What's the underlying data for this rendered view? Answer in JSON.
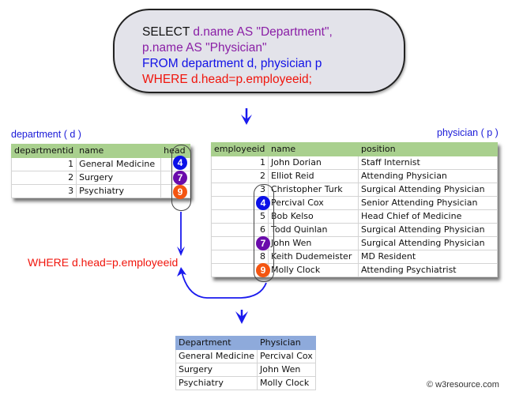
{
  "query": {
    "select_keyword": "SELECT",
    "select_expr1": "d.name AS \"Department\",",
    "select_expr2": "p.name AS \"Physician\"",
    "from_clause": "FROM department d, physician p",
    "where_clause": "WHERE d.head=p.employeeid;"
  },
  "department_table": {
    "caption": "department ( d )",
    "columns": [
      "departmentid",
      "name",
      "head"
    ],
    "rows": [
      {
        "departmentid": "1",
        "name": "General Medicine",
        "head": "4"
      },
      {
        "departmentid": "2",
        "name": "Surgery",
        "head": "7"
      },
      {
        "departmentid": "3",
        "name": "Psychiatry",
        "head": "9"
      }
    ]
  },
  "physician_table": {
    "caption": "physician ( p )",
    "columns": [
      "employeeid",
      "name",
      "position"
    ],
    "rows": [
      {
        "employeeid": "1",
        "name": "John Dorian",
        "position": "Staff Internist"
      },
      {
        "employeeid": "2",
        "name": "Elliot Reid",
        "position": "Attending Physician"
      },
      {
        "employeeid": "3",
        "name": "Christopher Turk",
        "position": "Surgical Attending Physician"
      },
      {
        "employeeid": "4",
        "name": "Percival Cox",
        "position": "Senior Attending Physician"
      },
      {
        "employeeid": "5",
        "name": "Bob Kelso",
        "position": "Head Chief of Medicine"
      },
      {
        "employeeid": "6",
        "name": "Todd Quinlan",
        "position": "Surgical Attending Physician"
      },
      {
        "employeeid": "7",
        "name": "John Wen",
        "position": "Surgical Attending Physician"
      },
      {
        "employeeid": "8",
        "name": "Keith Dudemeister",
        "position": "MD Resident"
      },
      {
        "employeeid": "9",
        "name": "Molly Clock",
        "position": "Attending Psychiatrist"
      }
    ]
  },
  "badges": [
    {
      "value": "4",
      "color": "#0b10e8"
    },
    {
      "value": "7",
      "color": "#6a0bab"
    },
    {
      "value": "9",
      "color": "#f45511"
    }
  ],
  "join_condition_label": "WHERE d.head=p.employeeid",
  "result_table": {
    "columns": [
      "Department",
      "Physician"
    ],
    "rows": [
      {
        "department": "General Medicine",
        "physician": "Percival Cox"
      },
      {
        "department": "Surgery",
        "physician": "John Wen"
      },
      {
        "department": "Psychiatry",
        "physician": "Molly Clock"
      }
    ]
  },
  "footer": {
    "copyright_icon": "©",
    "site": "w3resource.com"
  },
  "colors": {
    "arrow": "#1a1aee",
    "header_green": "#a9d08e",
    "header_blue": "#8eaadb",
    "where_red": "#f0150c"
  }
}
